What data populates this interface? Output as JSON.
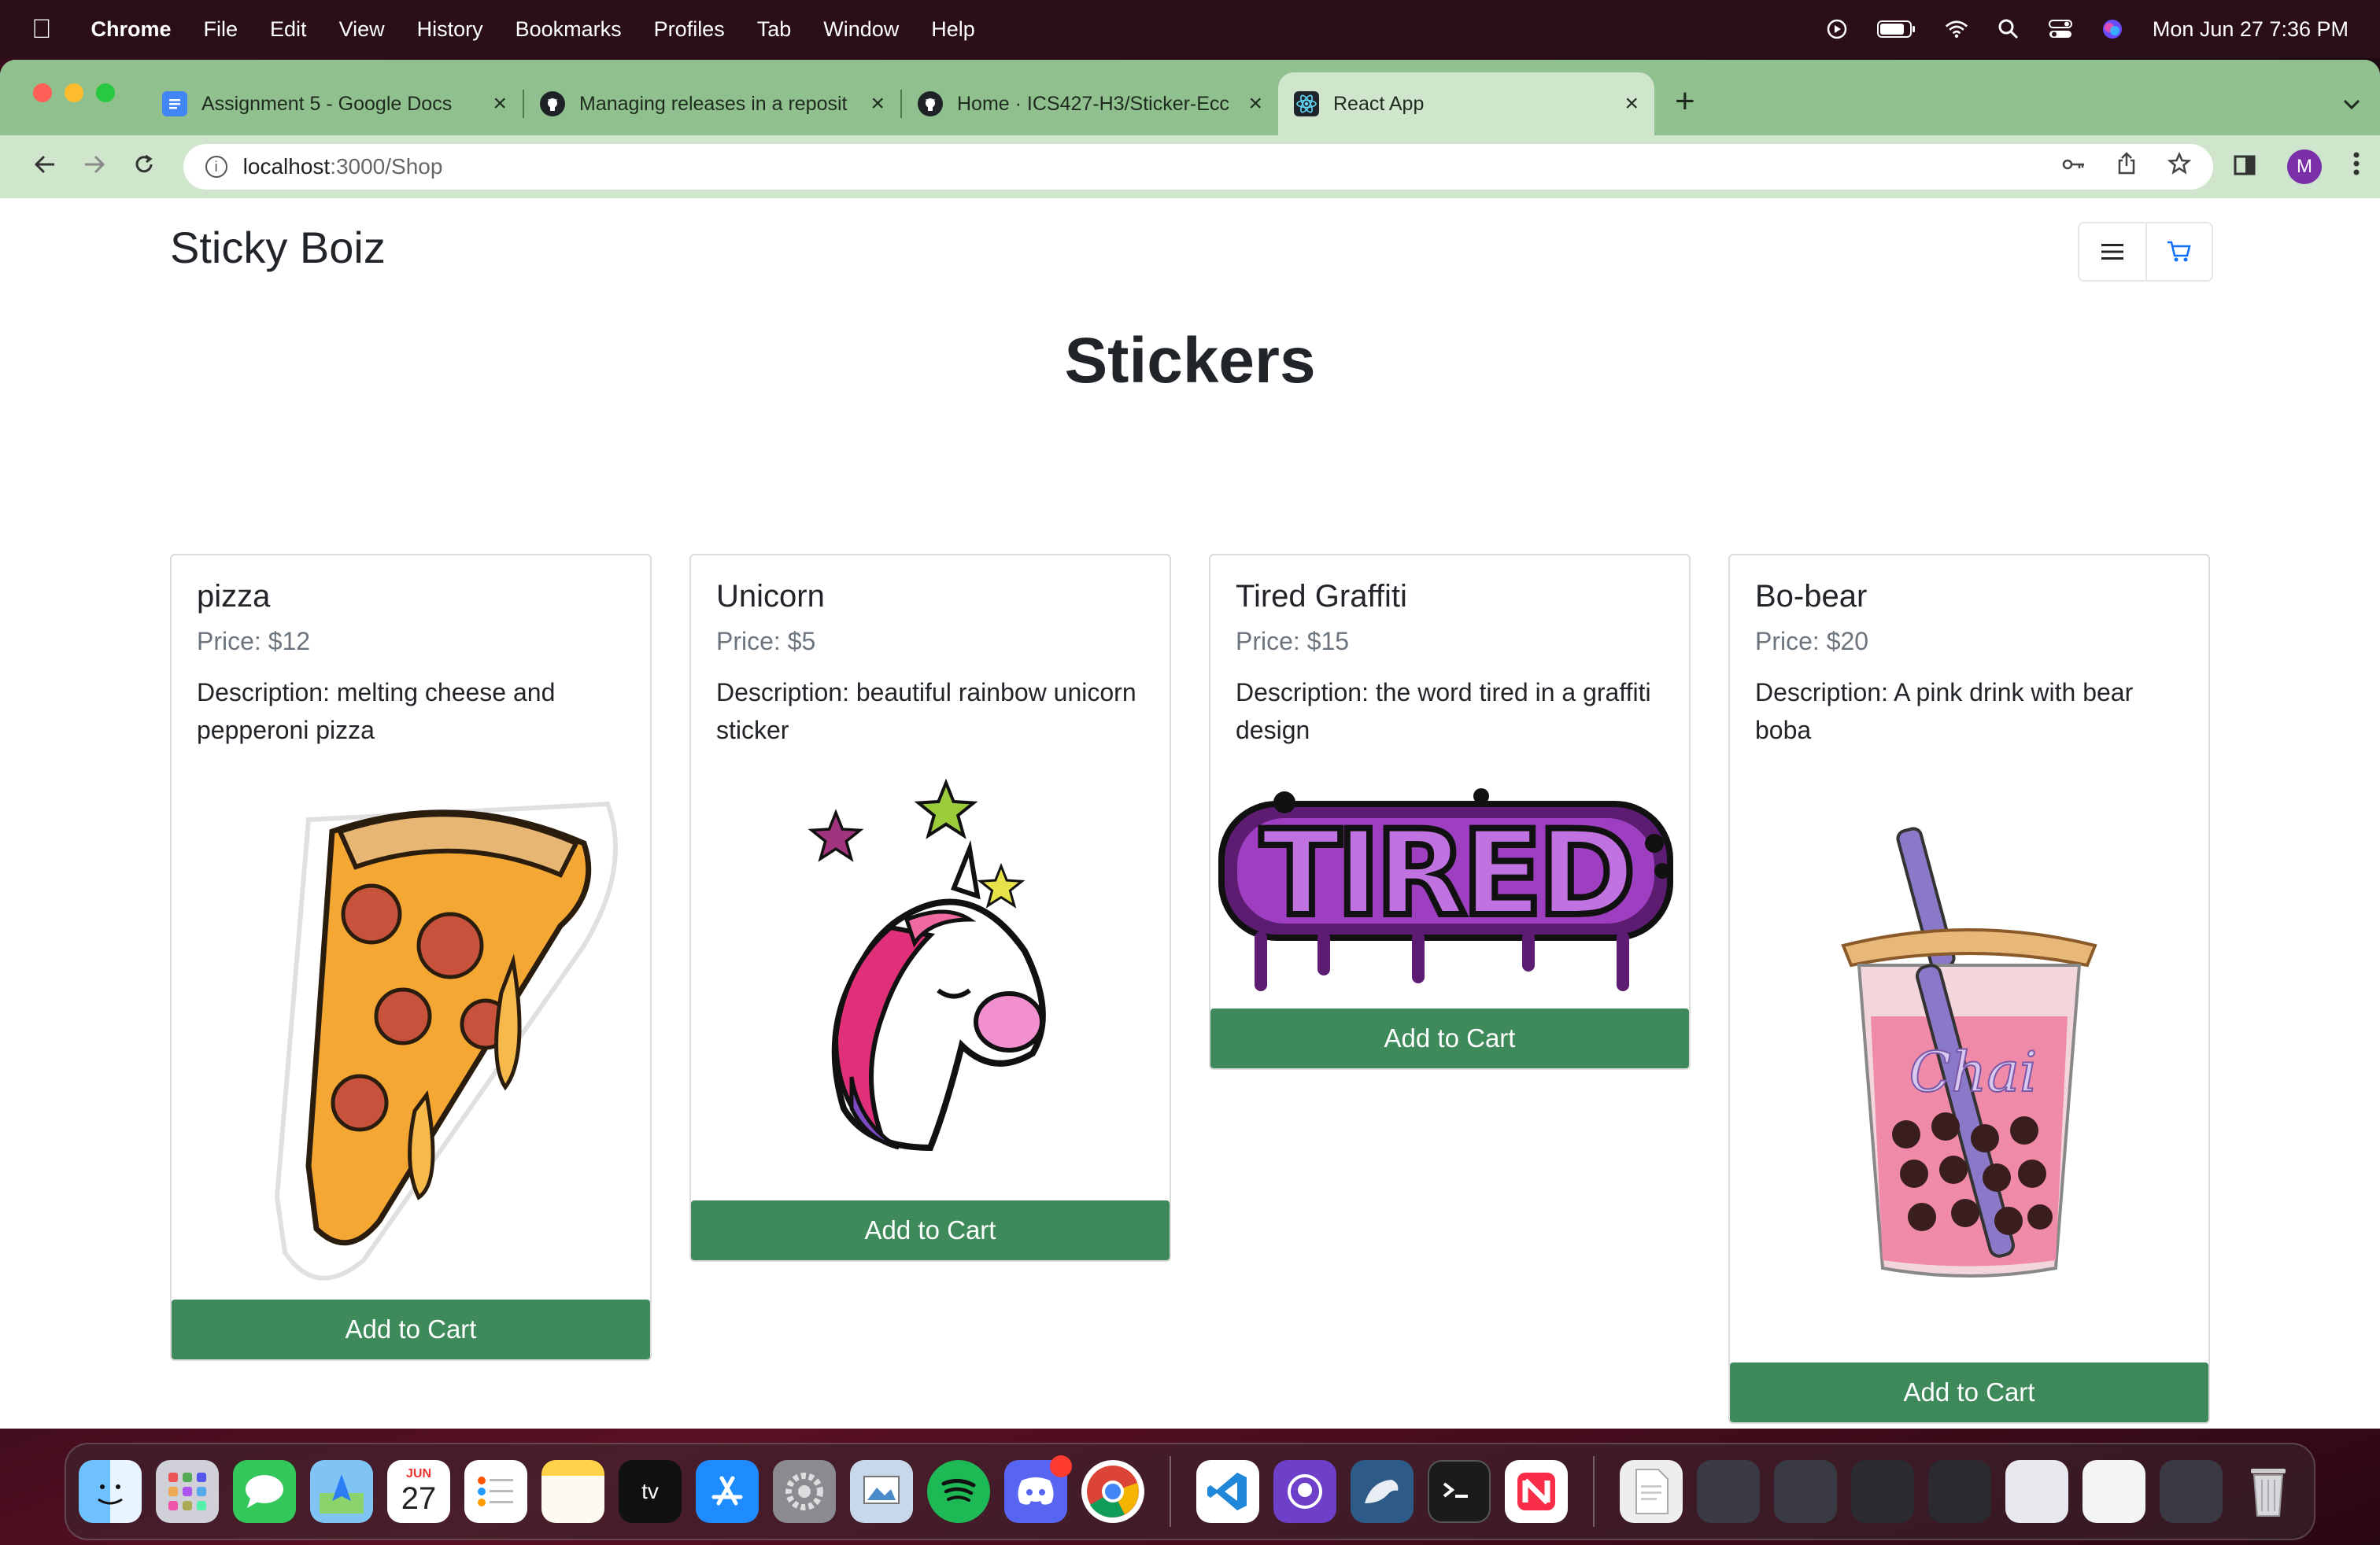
{
  "menubar": {
    "app": "Chrome",
    "items": [
      "File",
      "Edit",
      "View",
      "History",
      "Bookmarks",
      "Profiles",
      "Tab",
      "Window",
      "Help"
    ],
    "datetime": "Mon Jun 27  7:36 PM"
  },
  "tabs": [
    {
      "title": "Assignment 5 - Google Docs",
      "favicon": "google-docs-icon",
      "color": "#4285f4"
    },
    {
      "title": "Managing releases in a reposit",
      "favicon": "github-icon",
      "color": "#1f2328"
    },
    {
      "title": "Home · ICS427-H3/Sticker-Ecc",
      "favicon": "github-icon",
      "color": "#1f2328"
    },
    {
      "title": "React App",
      "favicon": "react-icon",
      "color": "#61dafb"
    }
  ],
  "address": {
    "host": "localhost",
    "path": ":3000/Shop"
  },
  "profile_initial": "M",
  "page": {
    "brand": "Sticky Boiz",
    "title": "Stickers",
    "add_label": "Add to Cart"
  },
  "products": [
    {
      "name": "pizza",
      "price": "Price: $12",
      "description": "Description: melting cheese and pepperoni pizza",
      "image": "pizza-sticker"
    },
    {
      "name": "Unicorn",
      "price": "Price: $5",
      "description": "Description: beautiful rainbow unicorn sticker",
      "image": "unicorn-sticker"
    },
    {
      "name": "Tired Graffiti",
      "price": "Price: $15",
      "description": "Description: the word tired in a graffiti design",
      "image": "tired-graffiti-sticker",
      "image_text": "TIRED"
    },
    {
      "name": "Bo-bear",
      "price": "Price: $20",
      "description": "Description: A pink drink with bear boba",
      "image": "boba-sticker",
      "image_text": "Chai"
    }
  ],
  "dock": {
    "calendar_month": "JUN",
    "calendar_day": "27",
    "tv_label": "tv",
    "discord_badge": ""
  },
  "colors": {
    "tabstrip": "#8fc08d",
    "toolbar": "#cfe6cc",
    "button": "#3e8a5b"
  }
}
